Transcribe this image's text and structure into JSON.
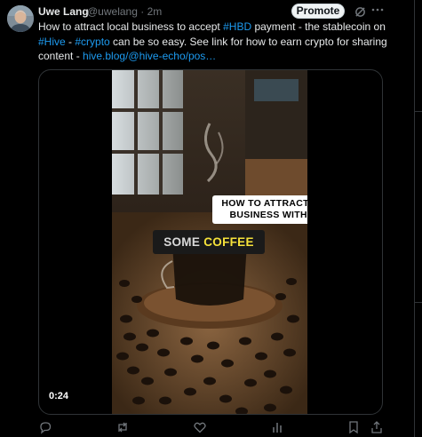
{
  "post": {
    "author_name": "Uwe Lang",
    "author_handle": "@uwelang",
    "separator": "·",
    "time": "2m",
    "promote_label": "Promote",
    "text": {
      "part1": "How to attract local business to accept ",
      "hashtag1": "#HBD",
      "part2": " payment - the stablecoin on ",
      "hashtag2": "#Hive",
      "part3": " - ",
      "hashtag3": "#crypto",
      "part4": " can be so easy. See link for how to earn crypto for sharing content - ",
      "link": "hive.blog/@hive-echo/pos…"
    },
    "media": {
      "caption_line1": "HOW TO ATTRACT LOCAL",
      "caption_line2": "BUSINESS WITH HBD?",
      "caption_word1": "SOME",
      "caption_word2": "COFFEE",
      "duration": "0:24"
    },
    "icons": [
      "avatar",
      "grok-icon",
      "more-icon",
      "reply-icon",
      "repost-icon",
      "like-icon",
      "views-icon",
      "bookmark-icon",
      "share-icon"
    ]
  },
  "colors": {
    "link": "#1d9bf0",
    "background": "#000000",
    "caption_yellow": "#f6e23a"
  }
}
